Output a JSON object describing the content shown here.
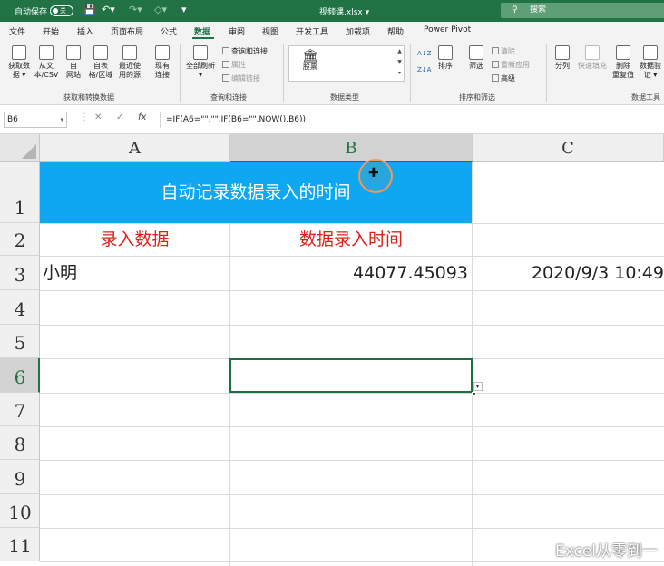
{
  "titlebar": {
    "autosave_label": "自动保存",
    "autosave_state": "关",
    "filename": "视频课.xlsx",
    "filename_caret": "▾",
    "search_placeholder": "搜索"
  },
  "tabs": [
    "文件",
    "开始",
    "插入",
    "页面布局",
    "公式",
    "数据",
    "审阅",
    "视图",
    "开发工具",
    "加载项",
    "帮助",
    "Power Pivot"
  ],
  "active_tab_index": 5,
  "ribbon": {
    "get_data": {
      "line1": "获取数",
      "line2": "据 ▾"
    },
    "from_csv": {
      "line1": "从文",
      "line2": "本/CSV"
    },
    "from_web": {
      "line1": "自",
      "line2": "网站"
    },
    "from_table": {
      "line1": "自表",
      "line2": "格/区域"
    },
    "recent_sources": {
      "line1": "最近使",
      "line2": "用的源"
    },
    "existing_conn": {
      "line1": "现有",
      "line2": "连接"
    },
    "group_get_transform": "获取和转换数据",
    "refresh_all": {
      "line1": "全部刷新",
      "line2": "▾"
    },
    "queries_connections": "查询和连接",
    "properties": "属性",
    "edit_links": "编辑链接",
    "group_queries": "查询和连接",
    "stocks": "股票",
    "group_datatypes": "数据类型",
    "sort_az": "A↓Z",
    "sort_za": "Z↓A",
    "sort": "排序",
    "filter": "筛选",
    "clear": "清除",
    "reapply": "重新应用",
    "advanced": "高级",
    "group_sort_filter": "排序和筛选",
    "text_to_columns": "分列",
    "flash_fill": "快速填充",
    "remove_duplicates": {
      "line1": "删除",
      "line2": "重复值"
    },
    "data_validation": {
      "line1": "数据验",
      "line2": "证 ▾"
    },
    "group_data_tools": "数据工具"
  },
  "formula_bar": {
    "name_box": "B6",
    "cancel": "✕",
    "enter": "✓",
    "fx": "fx",
    "formula": "=IF(A6=\"\",\"\",IF(B6=\"\",NOW(),B6))"
  },
  "grid": {
    "columns": [
      "A",
      "B",
      "C"
    ],
    "selected_column": "B",
    "rows": [
      "1",
      "2",
      "3",
      "4",
      "5",
      "6",
      "7",
      "8",
      "9",
      "10",
      "11"
    ],
    "selected_row": "6",
    "cells": {
      "A1": "自动记录数据录入的时间",
      "A2": "录入数据",
      "B2": "数据录入时间",
      "A3": "小明",
      "B3": "44077.45093",
      "C3": "2020/9/3 10:49"
    },
    "title_fill": "#0FA7F2",
    "header_color": "#E0201B"
  },
  "watermark": "Excel从零到一",
  "colors": {
    "excel_green": "#217346"
  }
}
